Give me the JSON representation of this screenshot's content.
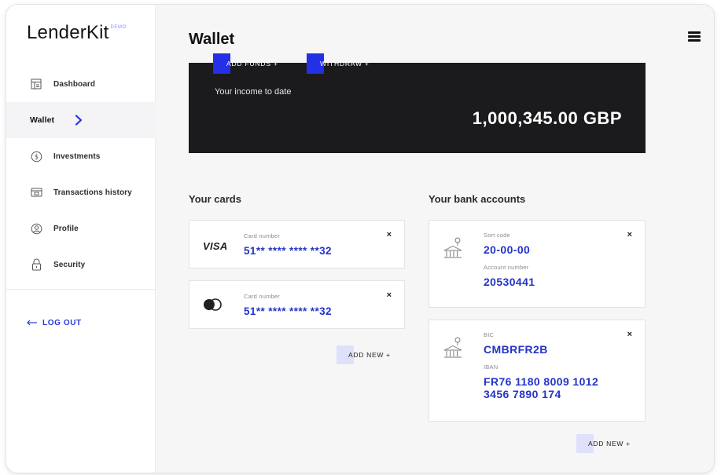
{
  "app": {
    "logo": "LenderKit",
    "logo_badge": "DEMO"
  },
  "sidebar": {
    "items": [
      {
        "label": "Dashboard",
        "icon": "dashboard-icon"
      },
      {
        "label": "Wallet",
        "icon": "chevron-right-icon",
        "active": true
      },
      {
        "label": "Investments",
        "icon": "dollar-coin-icon"
      },
      {
        "label": "Transactions history",
        "icon": "wallet-card-icon"
      },
      {
        "label": "Profile",
        "icon": "user-circle-icon"
      },
      {
        "label": "Security",
        "icon": "lock-icon"
      }
    ],
    "logout_label": "LOG OUT"
  },
  "header": {
    "title": "Wallet"
  },
  "income": {
    "caption": "Your income to date",
    "amount": "1,000,345.00 GBP",
    "add_funds_label": "ADD FUNDS  +",
    "withdraw_label": "WITHDRAW  +"
  },
  "cards_section": {
    "title": "Your cards",
    "cards": [
      {
        "brand": "VISA",
        "number_label": "Card number",
        "number": "51** **** **** **32"
      },
      {
        "brand": "mastercard",
        "number_label": "Card number",
        "number": "51** **** **** **32"
      }
    ],
    "add_new_label": "ADD NEW  +"
  },
  "banks_section": {
    "title": "Your bank accounts",
    "accounts": [
      {
        "sort_code_label": "Sort code",
        "sort_code": "20-00-00",
        "account_number_label": "Account number",
        "account_number": "20530441"
      },
      {
        "bic_label": "BIC",
        "bic": "CMBRFR2B",
        "iban_label": "IBAN",
        "iban_line1": "FR76 1180 8009 1012",
        "iban_line2": "3456 7890 174"
      }
    ],
    "add_new_label": "ADD NEW  +"
  },
  "colors": {
    "accent": "#2330e6",
    "accent_text": "#2433c9",
    "dark_panel": "#1b1b1d",
    "add_new_mark": "#dfe1fb"
  },
  "close_glyph": "×"
}
